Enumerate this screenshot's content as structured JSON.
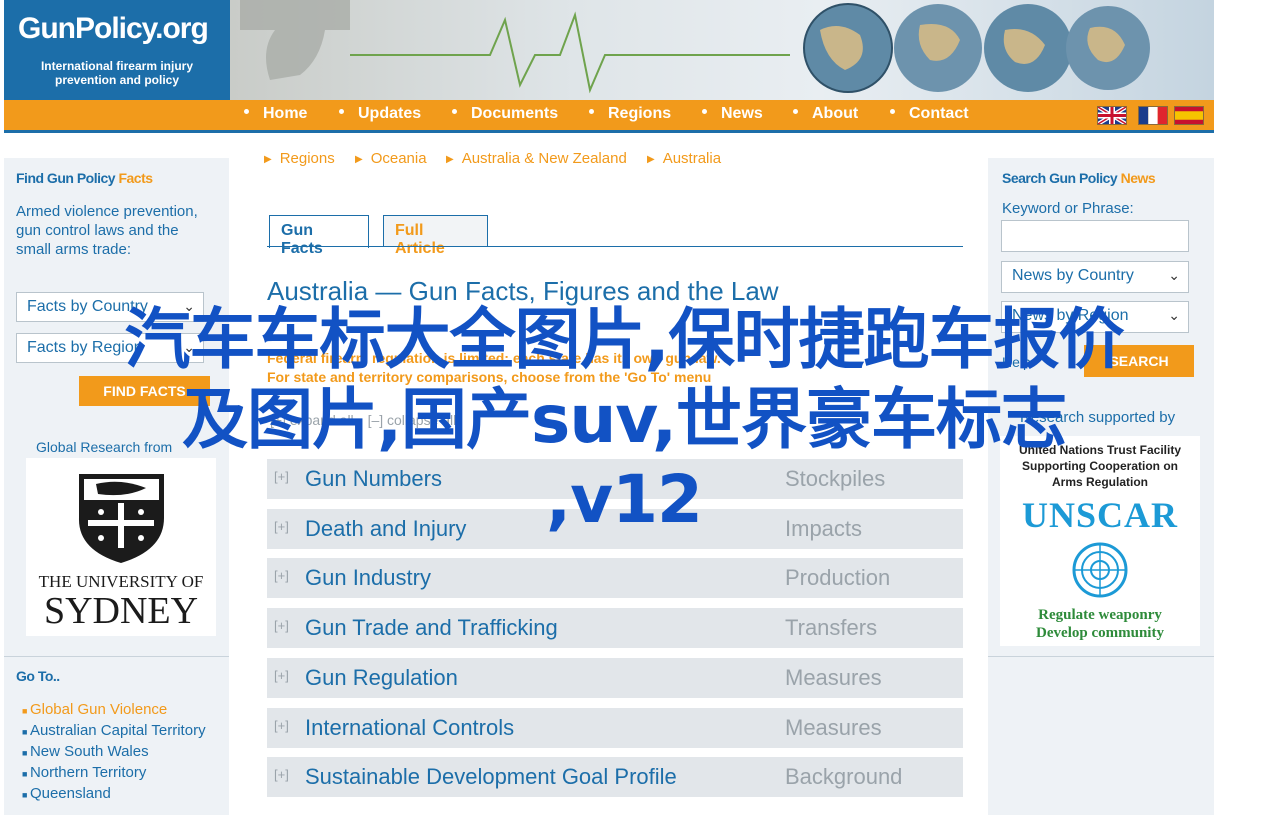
{
  "logo": {
    "title": "GunPolicy.org",
    "subtitle": "International firearm injury prevention and policy"
  },
  "nav": {
    "items": [
      "Home",
      "Updates",
      "Documents",
      "Regions",
      "News",
      "About",
      "Contact"
    ]
  },
  "left": {
    "facts_box": {
      "head_blue": "Find Gun Policy",
      "head_orange": "Facts",
      "description": "Armed violence prevention, gun control laws and the small arms trade:",
      "select_country": "Facts by Country",
      "select_region": "Facts by Region",
      "button": "FIND FACTS"
    },
    "research_label": "Global Research from",
    "university": {
      "line1": "THE UNIVERSITY OF",
      "line2": "SYDNEY"
    },
    "goto": {
      "title": "Go To..",
      "items": [
        "Global Gun Violence",
        "Australian Capital Territory",
        "New South Wales",
        "Northern Territory",
        "Queensland"
      ]
    }
  },
  "breadcrumb": [
    "Regions",
    "Oceania",
    "Australia & New Zealand",
    "Australia"
  ],
  "tabs": [
    "Gun Facts",
    "Full Article"
  ],
  "main": {
    "title": "Australia — Gun Facts, Figures and the Law",
    "notice1": "Federal firearm regulation is limited; each state has its own gun law.",
    "notice2": "For state and territory comparisons, choose from the 'Go To' menu",
    "expand_all": "[+] expand all",
    "collapse_all": "[–] collapse all",
    "plus": "[+]",
    "rows": [
      {
        "label": "Gun Numbers",
        "category": "Stockpiles"
      },
      {
        "label": "Death and Injury",
        "category": "Impacts"
      },
      {
        "label": "Gun Industry",
        "category": "Production"
      },
      {
        "label": "Gun Trade and Trafficking",
        "category": "Transfers"
      },
      {
        "label": "Gun Regulation",
        "category": "Measures"
      },
      {
        "label": "International Controls",
        "category": "Measures"
      },
      {
        "label": "Sustainable Development Goal Profile",
        "category": "Background"
      }
    ]
  },
  "right": {
    "head_blue": "Search Gun Policy",
    "head_orange": "News",
    "keyword_label": "Keyword or Phrase:",
    "select_country": "News by Country",
    "select_region": "News by Region",
    "help": "Help",
    "search_button": "SEARCH",
    "research_label": "Research supported by",
    "unscar": {
      "line1": "United Nations Trust Facility",
      "line2": "Supporting Cooperation on",
      "line3": "Arms Regulation",
      "name": "UNSCAR",
      "tag1": "Regulate weaponry",
      "tag2": "Develop community"
    }
  },
  "overlay": {
    "line1": "汽车车标大全图片,保时捷跑车报价",
    "line2": "及图片,国产suv,世界豪车标志",
    "line3": ",v12"
  },
  "colors": {
    "blue": "#1c6ea9",
    "orange": "#f29a1b",
    "grey_row": "#e2e6ea",
    "overlay": "#1252c4"
  }
}
